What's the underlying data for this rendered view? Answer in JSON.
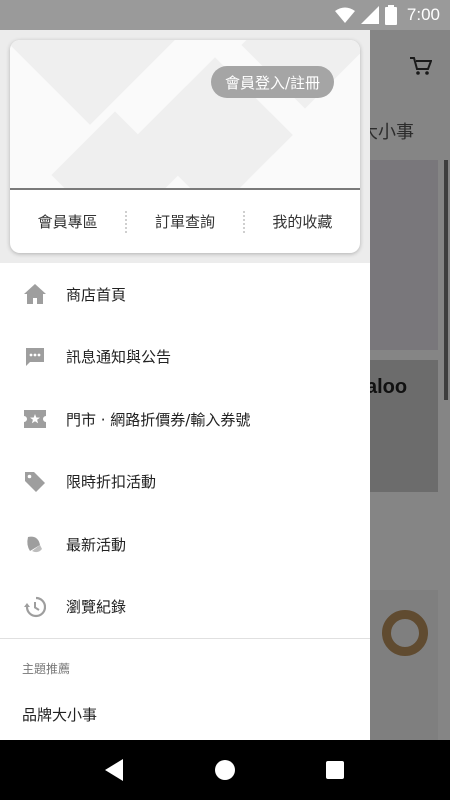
{
  "status_bar": {
    "time": "7:00"
  },
  "background": {
    "title_fragment": "大小事",
    "logo_fragment": "aloo"
  },
  "member_card": {
    "login_label": "會員登入/註冊",
    "links": [
      "會員專區",
      "訂單查詢",
      "我的收藏"
    ]
  },
  "menu": {
    "items": [
      {
        "label": "商店首頁",
        "icon": "home-icon"
      },
      {
        "label": "訊息通知與公告",
        "icon": "message-icon"
      },
      {
        "label": "門市 · 網路折價券/輸入券號",
        "icon": "coupon-icon"
      },
      {
        "label": "限時折扣活動",
        "icon": "tag-icon"
      },
      {
        "label": "最新活動",
        "icon": "campaign-icon"
      },
      {
        "label": "瀏覽紀錄",
        "icon": "history-icon"
      }
    ]
  },
  "section": {
    "title": "主題推薦",
    "items": [
      "品牌大小事"
    ]
  },
  "colors": {
    "icon_gray": "#9e9e9e",
    "login_bg": "#a5a5a5",
    "scrim": "rgba(0,0,0,0.48)"
  }
}
